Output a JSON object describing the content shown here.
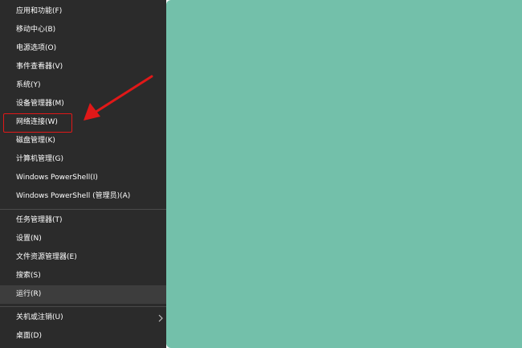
{
  "menu": {
    "items": [
      {
        "label": "应用和功能(F)"
      },
      {
        "label": "移动中心(B)"
      },
      {
        "label": "电源选项(O)"
      },
      {
        "label": "事件查看器(V)"
      },
      {
        "label": "系统(Y)"
      },
      {
        "label": "设备管理器(M)"
      },
      {
        "label": "网络连接(W)"
      },
      {
        "label": "磁盘管理(K)"
      },
      {
        "label": "计算机管理(G)"
      },
      {
        "label": "Windows PowerShell(I)"
      },
      {
        "label": "Windows PowerShell (管理员)(A)"
      },
      {
        "label": "任务管理器(T)"
      },
      {
        "label": "设置(N)"
      },
      {
        "label": "文件资源管理器(E)"
      },
      {
        "label": "搜索(S)"
      },
      {
        "label": "运行(R)"
      },
      {
        "label": "关机或注销(U)"
      },
      {
        "label": "桌面(D)"
      }
    ]
  },
  "colors": {
    "menu_background": "#2b2b2b",
    "desktop_teal": "#73c0aa",
    "annotation_red": "#e01818"
  },
  "icons": {
    "submenu": "chevron-right-icon"
  },
  "annotation": {
    "highlighted_item": "网络连接(W)"
  }
}
